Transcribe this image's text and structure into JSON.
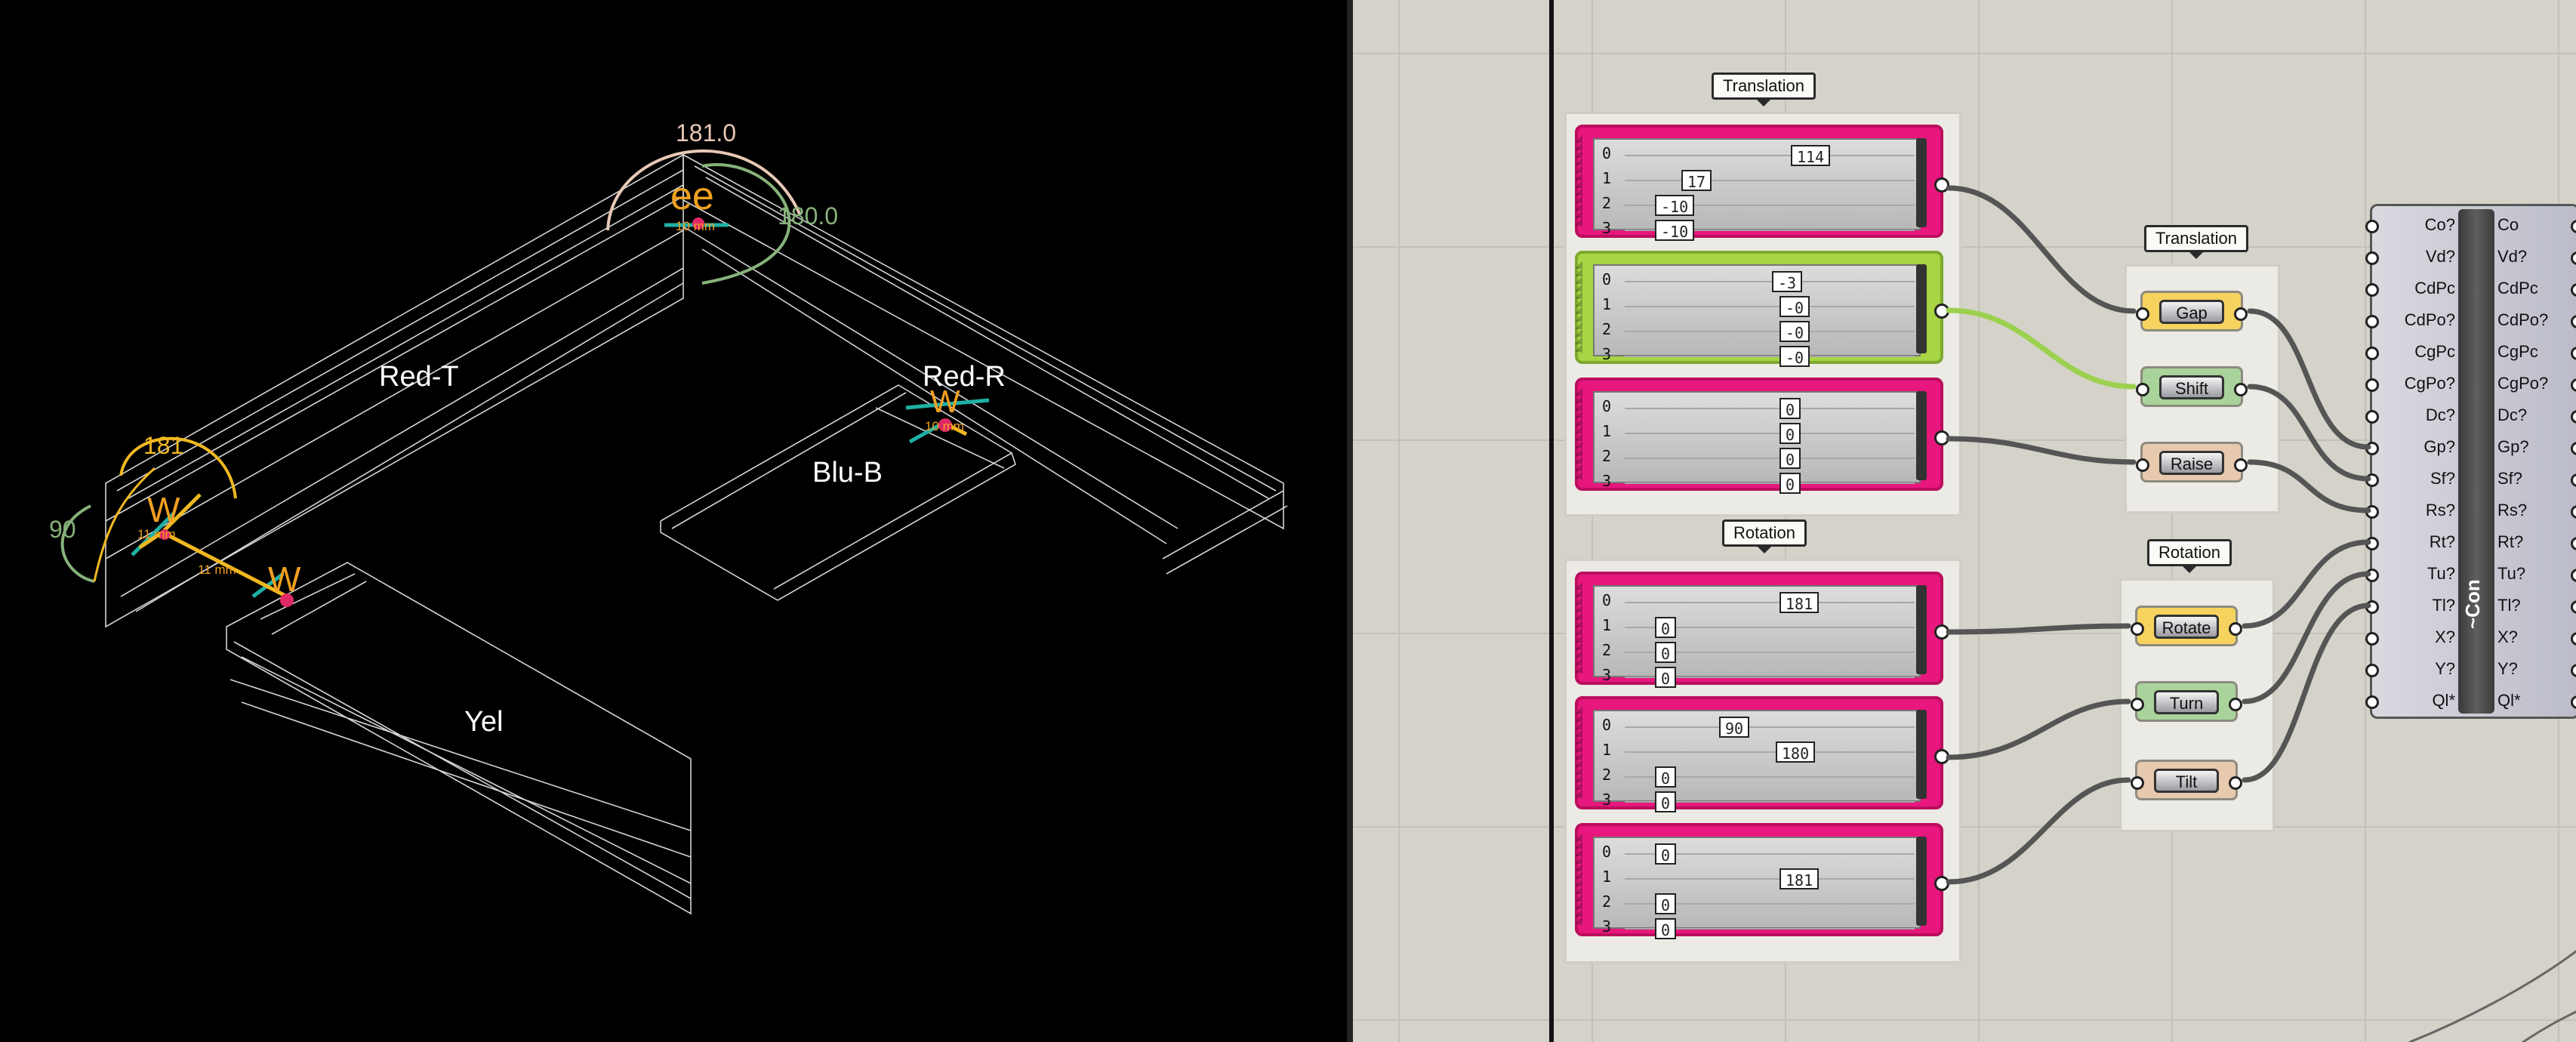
{
  "viewport": {
    "labels": {
      "red_t": "Red-T",
      "red_r": "Red-R",
      "blu_b": "Blu-B",
      "yel": "Yel",
      "angle_top": "181.0",
      "angle_right": "180.0",
      "angle_left": "181",
      "angle_90": "90",
      "gumball_top": "ee",
      "gumball_mid": "W",
      "gumball_left": "W",
      "gumball_bottom": "W",
      "dist_top": "10 mm",
      "dist_mid": "10 mm",
      "dist_left": "11 mm",
      "dist_bottom": "11 mm"
    },
    "colors": {
      "background": "#000000",
      "wire": "#d8d8d8",
      "gumball": "#f0a020",
      "arrow": "#20b0a8",
      "arc_pink": "#e8c0b0",
      "arc_green": "#8ab87a"
    }
  },
  "canvas": {
    "groups": {
      "translation_left": "Translation",
      "rotation_left": "Rotation",
      "translation_right": "Translation",
      "rotation_right": "Rotation"
    },
    "sliders": [
      {
        "color": "pink",
        "indices": [
          "0",
          "1",
          "2",
          "3"
        ],
        "values": [
          "114",
          "17",
          "-10",
          "-10"
        ]
      },
      {
        "color": "green",
        "indices": [
          "0",
          "1",
          "2",
          "3"
        ],
        "values": [
          "-3",
          "-0",
          "-0",
          "-0"
        ]
      },
      {
        "color": "pink",
        "indices": [
          "0",
          "1",
          "2",
          "3"
        ],
        "values": [
          "0",
          "0",
          "0",
          "0"
        ]
      },
      {
        "color": "pink",
        "indices": [
          "0",
          "1",
          "2",
          "3"
        ],
        "values": [
          "181",
          "0",
          "0",
          "0"
        ]
      },
      {
        "color": "pink",
        "indices": [
          "0",
          "1",
          "2",
          "3"
        ],
        "values": [
          "90",
          "180",
          "0",
          "0"
        ]
      },
      {
        "color": "pink",
        "indices": [
          "0",
          "1",
          "2",
          "3"
        ],
        "values": [
          "0",
          "181",
          "0",
          "0"
        ]
      }
    ],
    "components": {
      "gap": "Gap",
      "shift": "Shift",
      "raise": "Raise",
      "rotate": "Rotate",
      "turn": "Turn",
      "tilt": "Tilt"
    },
    "big_component": {
      "title": "~Con",
      "inputs": [
        "Co?",
        "Vd?",
        "CdPc",
        "CdPo?",
        "CgPc",
        "CgPo?",
        "Dc?",
        "Gp?",
        "Sf?",
        "Rs?",
        "Rt?",
        "Tu?",
        "Tl?",
        "X?",
        "Y?",
        "Ql*"
      ],
      "outputs": [
        "Co",
        "Vd?",
        "CdPc",
        "CdPo?",
        "CgPc",
        "CgPo?",
        "Dc?",
        "Gp?",
        "Sf?",
        "Rs?",
        "Rt?",
        "Tu?",
        "Tl?",
        "X?",
        "Y?",
        "Ql*"
      ]
    },
    "colors": {
      "canvas_bg": "#d4d2c9",
      "slider_pink": "#e7177d",
      "slider_green": "#a7d544",
      "comp_yellow": "#f5d35e",
      "comp_green": "#a9d39a",
      "comp_peach": "#e7c9ae"
    }
  }
}
